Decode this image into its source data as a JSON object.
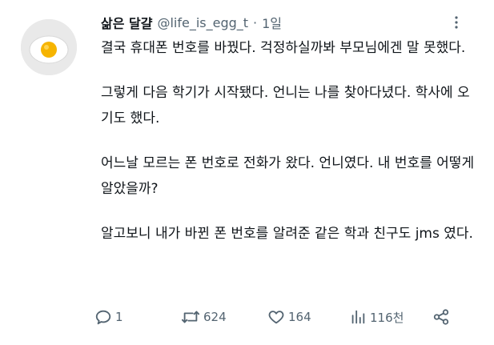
{
  "tweet": {
    "display_name": "삶은 달걀",
    "handle": "@life_is_egg_t",
    "separator": "·",
    "time": "1일",
    "paragraphs": [
      "결국 휴대폰 번호를 바꿨다. 걱정하실까봐 부모님에겐 말 못했다.",
      "그렇게 다음 학기가 시작됐다. 언니는 나를 찾아다녔다. 학사에 오기도 했다.",
      "어느날 모르는 폰 번호로 전화가 왔다. 언니였다. 내 번호를 어떻게 알았을까?",
      "알고보니 내가 바뀐 폰 번호를 알려준 같은 학과 친구도 jms 였다."
    ],
    "actions": {
      "reply_count": "1",
      "retweet_count": "624",
      "like_count": "164",
      "view_count": "116천"
    },
    "icons": {
      "avatar": "boiled-egg-icon",
      "more": "more-icon",
      "reply": "reply-icon",
      "retweet": "retweet-icon",
      "like": "heart-icon",
      "views": "views-icon",
      "share": "share-icon"
    },
    "colors": {
      "text": "#0f1419",
      "secondary": "#536471"
    }
  }
}
